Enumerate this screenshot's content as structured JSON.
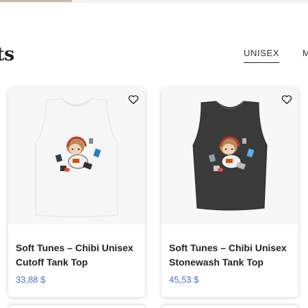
{
  "section": {
    "title_fragment": "ts"
  },
  "tabs": [
    {
      "label": "UNISEX",
      "active": true
    },
    {
      "label": "ME",
      "active": false
    }
  ],
  "products": [
    {
      "title": "Soft Tunes – Chibi Unisex Cutoff Tank Top",
      "price": "33,88 $",
      "garment_color": "#f6f6f6",
      "wishlist_icon": "heart-outline-icon"
    },
    {
      "title": "Soft Tunes – Chibi Unisex Stonewash Tank Top",
      "price": "45,53 $",
      "garment_color": "#3a3a3a",
      "wishlist_icon": "heart-outline-icon"
    }
  ],
  "colors": {
    "price": "#4a6fd0",
    "text": "#222222",
    "image_bg": "#f7f7f7"
  }
}
